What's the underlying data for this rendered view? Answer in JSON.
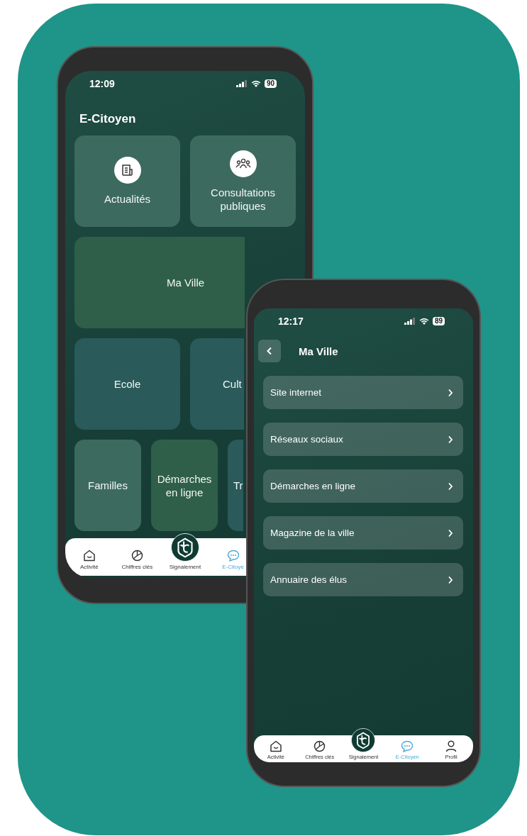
{
  "left_phone": {
    "status": {
      "time": "12:09",
      "battery": "90"
    },
    "title": "E-Citoyen",
    "tile_rows": [
      [
        {
          "label": "Actualités",
          "kind": "news",
          "color": "#3d6a5f"
        },
        {
          "label": "Consultations publiques",
          "kind": "people",
          "color": "#3d6a5f"
        }
      ],
      [
        {
          "label": "Ma Ville",
          "kind": "plain",
          "color": "#2f5f48"
        }
      ],
      [
        {
          "label": "Ecole",
          "kind": "plain",
          "color": "#2a5a5a"
        },
        {
          "label": "Cult",
          "kind": "cut",
          "color": "#2a5a5a"
        }
      ],
      [
        {
          "label": "Familles",
          "kind": "plain",
          "color": "#3d6a5f"
        },
        {
          "label": "Démarches en ligne",
          "kind": "plain",
          "color": "#2f5f48"
        },
        {
          "label": "Tr",
          "kind": "cut",
          "color": "#2a5a5a"
        }
      ]
    ],
    "nav": [
      {
        "label": "Activité",
        "kind": "home",
        "selected": false
      },
      {
        "label": "Chiffres clés",
        "kind": "chart",
        "selected": false
      },
      {
        "label": "Signalement",
        "kind": "logo",
        "selected": false
      },
      {
        "label": "E-Citoye",
        "kind": "chat",
        "selected": true
      }
    ]
  },
  "right_phone": {
    "status": {
      "time": "12:17",
      "battery": "89"
    },
    "title": "Ma Ville",
    "items": [
      {
        "label": "Site internet"
      },
      {
        "label": "Réseaux sociaux"
      },
      {
        "label": "Démarches en ligne"
      },
      {
        "label": "Magazine de la ville"
      },
      {
        "label": "Annuaire des élus"
      }
    ],
    "nav": [
      {
        "label": "Activité",
        "kind": "home",
        "selected": false
      },
      {
        "label": "Chiffres clés",
        "kind": "chart",
        "selected": false
      },
      {
        "label": "Signalement",
        "kind": "logo",
        "selected": false
      },
      {
        "label": "E-Citoyen",
        "kind": "chat",
        "selected": true
      },
      {
        "label": "Profil",
        "kind": "person",
        "selected": false
      }
    ]
  }
}
